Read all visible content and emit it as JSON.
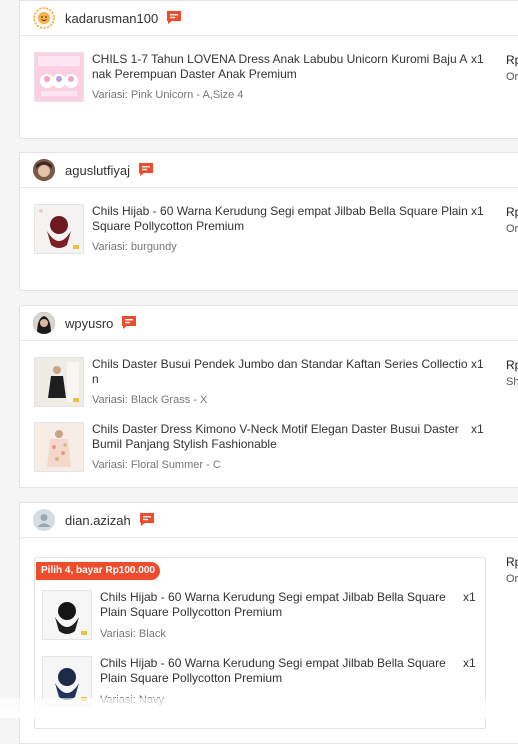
{
  "orders": [
    {
      "username": "kadarusman100",
      "price_prefix": "Rp",
      "status_prefix": "Or",
      "items": [
        {
          "name": "CHILS 1-7 Tahun LOVENA Dress Anak Labubu Unicorn Kuromi Baju Anak Perempuan Daster Anak Premium",
          "qty": "x1",
          "variant": "Variasi: Pink Unicorn - A,Size 4"
        }
      ]
    },
    {
      "username": "aguslutfiyaj",
      "price_prefix": "Rp",
      "status_prefix": "Or",
      "items": [
        {
          "name": "Chils Hijab - 60 Warna Kerudung Segi empat Jilbab Bella Square Plain Square Pollycotton Premium",
          "qty": "x1",
          "variant": "Variasi: burgundy"
        }
      ]
    },
    {
      "username": "wpyusro",
      "price_prefix": "Rp",
      "status_prefix": "Sh",
      "items": [
        {
          "name": "Chils Daster Busui Pendek Jumbo dan Standar Kaftan Series Collection",
          "qty": "x1",
          "variant": "Variasi: Black Grass - X"
        },
        {
          "name": "Chils Daster Dress Kimono V-Neck Motif Elegan Daster Busui Daster Bumil Panjang Stylish Fashionable",
          "qty": "x1",
          "variant": "Variasi: Floral Summer - C"
        }
      ]
    },
    {
      "username": "dian.azizah",
      "price_prefix": "Rp",
      "status_prefix": "Or",
      "bundle_label": "Pilih 4, bayar Rp100.000",
      "items": [
        {
          "name": "Chils Hijab - 60 Warna Kerudung Segi empat Jilbab Bella Square Plain Square Pollycotton Premium",
          "qty": "x1",
          "variant": "Variasi: Black"
        },
        {
          "name": "Chils Hijab - 60 Warna Kerudung Segi empat Jilbab Bella Square Plain Square Pollycotton Premium",
          "qty": "x1",
          "variant": "Variasi: Navy"
        }
      ]
    }
  ],
  "colors": {
    "accent": "#ee4d2d",
    "border": "#e3e3e3",
    "text": "#333333",
    "muted": "#777777"
  }
}
